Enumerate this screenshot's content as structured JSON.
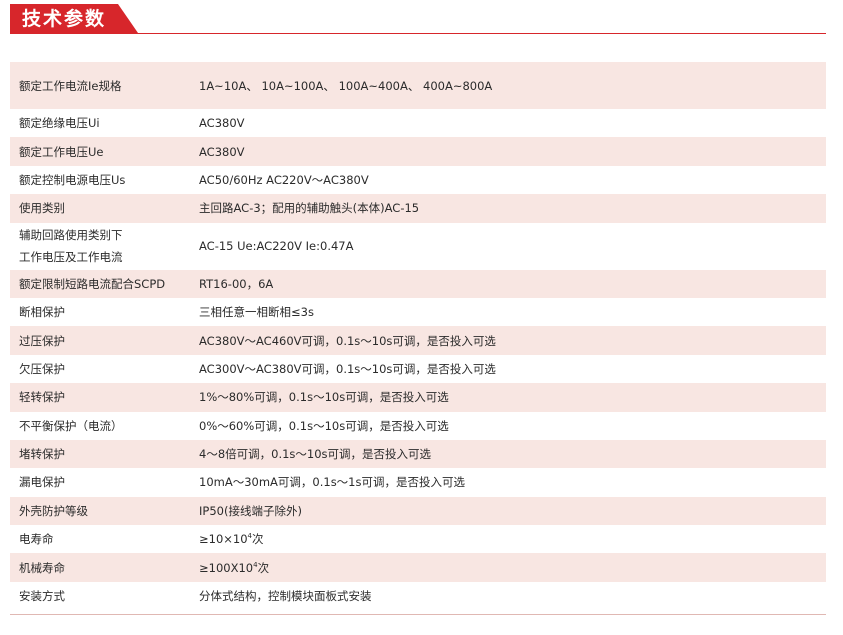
{
  "header": {
    "title": "技术参数",
    "accent_color": "#d7262b"
  },
  "rows": [
    {
      "label": "额定工作电流Ie规格",
      "value": "1A~10A、 10A~100A、 100A~400A、 400A~800A"
    },
    {
      "label": "额定绝缘电压Ui",
      "value": "AC380V"
    },
    {
      "label": "额定工作电压Ue",
      "value": "AC380V"
    },
    {
      "label": "额定控制电源电压Us",
      "value": "AC50/60Hz  AC220V～AC380V"
    },
    {
      "label": "使用类别",
      "value": "主回路AC-3；配用的辅助触头(本体)AC-15"
    },
    {
      "label_line1": "辅助回路使用类别下",
      "label_line2": "工作电压及工作电流",
      "value": "AC-15 Ue:AC220V  Ie:0.47A"
    },
    {
      "label": "额定限制短路电流配合SCPD",
      "value": "RT16-00，6A"
    },
    {
      "label": "断相保护",
      "value": "三相任意一相断相≤3s"
    },
    {
      "label": "过压保护",
      "value": "AC380V～AC460V可调，0.1s～10s可调，是否投入可选"
    },
    {
      "label": "欠压保护",
      "value": "AC300V～AC380V可调，0.1s～10s可调，是否投入可选"
    },
    {
      "label": "轻转保护",
      "value": "1%～80%可调，0.1s～10s可调，是否投入可选"
    },
    {
      "label": "不平衡保护（电流）",
      "value": "0%～60%可调，0.1s～10s可调，是否投入可选"
    },
    {
      "label": "堵转保护",
      "value": "4～8倍可调，0.1s～10s可调，是否投入可选"
    },
    {
      "label": "漏电保护",
      "value": "10mA～30mA可调，0.1s～1s可调，是否投入可选"
    },
    {
      "label": "外壳防护等级",
      "value": "IP50(接线端子除外)"
    },
    {
      "label": "电寿命",
      "value_prefix": "≥10×10",
      "value_sup": "4",
      "value_suffix": "次"
    },
    {
      "label": " 机械寿命",
      "value_prefix": "≥100X10",
      "value_sup": "4",
      "value_suffix": "次"
    },
    {
      "label": "安装方式",
      "value": "分体式结构，控制模块面板式安装"
    }
  ]
}
